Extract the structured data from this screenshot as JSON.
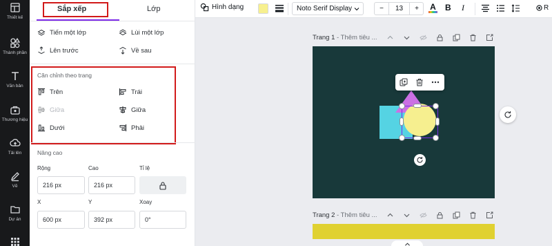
{
  "rail": {
    "items": [
      {
        "label": "Thiết kế",
        "icon": "layout-icon"
      },
      {
        "label": "Thành phần",
        "icon": "shapes-icon"
      },
      {
        "label": "Văn bản",
        "icon": "text-icon"
      },
      {
        "label": "Thương hiệu",
        "icon": "brand-icon"
      },
      {
        "label": "Tải lên",
        "icon": "upload-icon"
      },
      {
        "label": "Vẽ",
        "icon": "draw-icon"
      },
      {
        "label": "Dự án",
        "icon": "folder-icon"
      }
    ]
  },
  "panel": {
    "tabs": [
      {
        "label": "Sắp xếp",
        "active": true
      },
      {
        "label": "Lớp",
        "active": false
      }
    ],
    "order": {
      "forward": "Tiến một lớp",
      "backward": "Lùi một lớp",
      "to_front": "Lên trước",
      "to_back": "Về sau"
    },
    "align": {
      "title": "Căn chỉnh theo trang",
      "top": "Trên",
      "left": "Trái",
      "middle": "Giữa",
      "center": "Giữa",
      "bottom": "Dưới",
      "right": "Phải"
    },
    "advanced": {
      "title": "Nâng cao",
      "width_label": "Rộng",
      "width_value": "216 px",
      "height_label": "Cao",
      "height_value": "216 px",
      "ratio_label": "Tỉ lệ",
      "x_label": "X",
      "x_value": "600 px",
      "y_label": "Y",
      "y_value": "392 px",
      "rotate_label": "Xoay",
      "rotate_value": "0°"
    }
  },
  "toolbar": {
    "shape_label": "Hình dạng",
    "fill_color": "#f7f08f",
    "font_name": "Noto Serif Display",
    "font_size": "13",
    "decrease": "−",
    "increase": "+",
    "text_color_letter": "A",
    "bold": "B",
    "italic": "I",
    "ext_label": "R"
  },
  "pages": [
    {
      "label": "Trang 1",
      "placeholder": " - Thêm tiêu ...",
      "background": "#18393a"
    },
    {
      "label": "Trang 2",
      "placeholder": " - Thêm tiêu ...",
      "background": "#e0d131"
    }
  ],
  "colors": {
    "accent": "#7d2ae8",
    "highlight_box": "#d11919",
    "square": "#55d3e3",
    "circle": "#f6ef8f",
    "triangle": "#cb70e4"
  }
}
